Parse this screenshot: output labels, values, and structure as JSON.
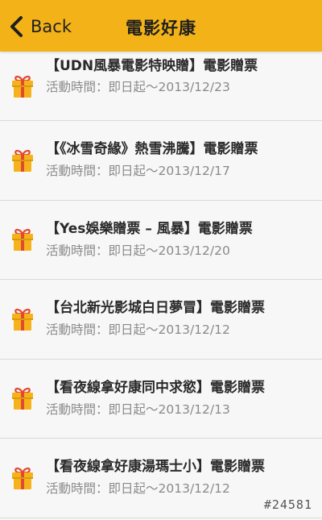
{
  "nav": {
    "back_label": "Back",
    "title": "電影好康",
    "back_icon": "chevron-left-icon",
    "bar_color": "#f3b318"
  },
  "list": {
    "item_icon": "gift-icon",
    "items": [
      {
        "title": "【UDN風暴電影特映贈】電影贈票",
        "date": "活動時間：即日起～2013/12/23"
      },
      {
        "title": "【《冰雪奇緣》熱雪沸騰】電影贈票",
        "date": "活動時間：即日起～2013/12/17"
      },
      {
        "title": "【Yes娛樂贈票 – 風暴】電影贈票",
        "date": "活動時間：即日起～2013/12/20"
      },
      {
        "title": "【台北新光影城白日夢冒】電影贈票",
        "date": "活動時間：即日起～2013/12/12"
      },
      {
        "title": "【看夜線拿好康同中求慾】電影贈票",
        "date": "活動時間：即日起～2013/12/13"
      },
      {
        "title": "【看夜線拿好康湯瑪士小】電影贈票",
        "date": "活動時間：即日起～2013/12/12"
      }
    ]
  },
  "watermark": "#24581"
}
